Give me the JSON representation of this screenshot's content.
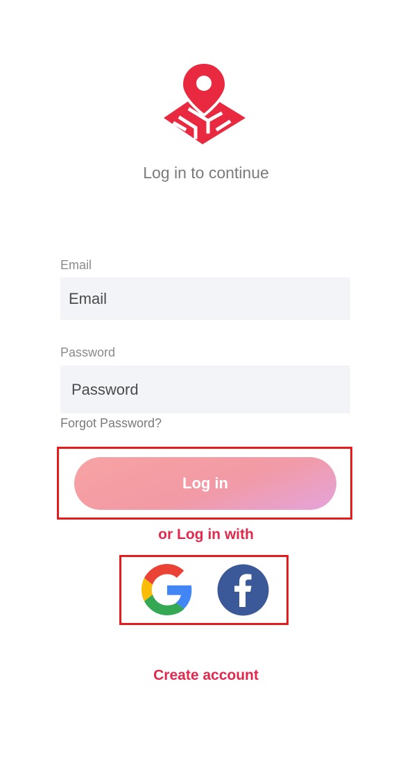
{
  "header": {
    "logo_icon": "map-pin-icon",
    "subtitle": "Log in to continue"
  },
  "form": {
    "email_label": "Email",
    "email_placeholder": "Email",
    "password_label": "Password",
    "password_placeholder": "Password",
    "forgot_label": "Forgot Password?",
    "login_label": "Log in"
  },
  "social": {
    "heading": "or Log in with",
    "providers": [
      {
        "name": "Google",
        "icon": "google-icon"
      },
      {
        "name": "Facebook",
        "icon": "facebook-icon"
      }
    ]
  },
  "footer": {
    "create_account_label": "Create account"
  },
  "colors": {
    "accent": "#e0294c",
    "logo_red": "#e8293f",
    "input_bg": "#f2f4f8",
    "highlight": "#e61b1b",
    "facebook_blue": "#3b5998"
  }
}
